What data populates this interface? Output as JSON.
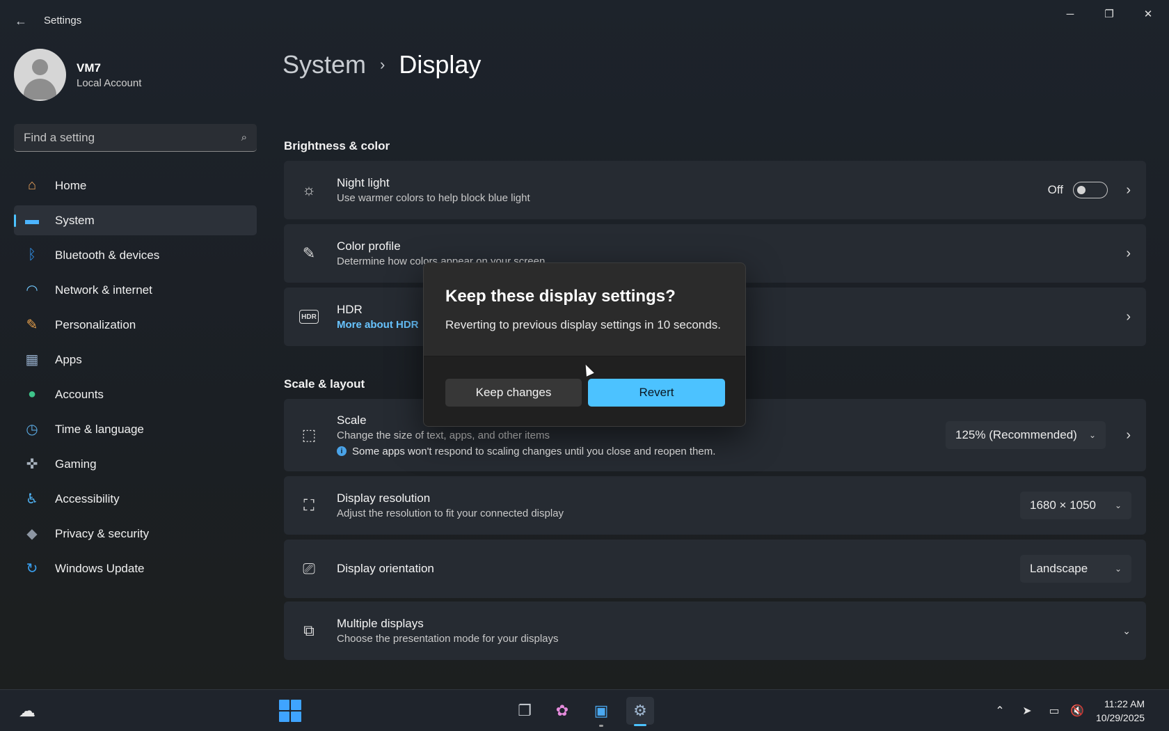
{
  "window": {
    "app_title": "Settings",
    "back_icon": "back-arrow-icon",
    "controls": {
      "minimize": "─",
      "maximize": "❐",
      "close": "✕"
    }
  },
  "profile": {
    "name": "VM7",
    "account_type": "Local Account"
  },
  "search": {
    "placeholder": "Find a setting",
    "icon": "⌕"
  },
  "sidebar": {
    "items": [
      {
        "label": "Home",
        "icon": "⌂",
        "icon_color": "#e8a15a",
        "active": false
      },
      {
        "label": "System",
        "icon": "▬",
        "icon_color": "#4cb4ff",
        "active": true
      },
      {
        "label": "Bluetooth & devices",
        "icon": "ᛒ",
        "icon_color": "#2f8de4",
        "active": false
      },
      {
        "label": "Network & internet",
        "icon": "◠",
        "icon_color": "#6fc3f7",
        "active": false
      },
      {
        "label": "Personalization",
        "icon": "✎",
        "icon_color": "#e9a14c",
        "active": false
      },
      {
        "label": "Apps",
        "icon": "▦",
        "icon_color": "#8fa6c2",
        "active": false
      },
      {
        "label": "Accounts",
        "icon": "●",
        "icon_color": "#3ec48a",
        "active": false
      },
      {
        "label": "Time & language",
        "icon": "◷",
        "icon_color": "#5aa8e0",
        "active": false
      },
      {
        "label": "Gaming",
        "icon": "✜",
        "icon_color": "#a8b2be",
        "active": false
      },
      {
        "label": "Accessibility",
        "icon": "♿",
        "icon_color": "#4fb0f0",
        "active": false
      },
      {
        "label": "Privacy & security",
        "icon": "◆",
        "icon_color": "#8d96a3",
        "active": false
      },
      {
        "label": "Windows Update",
        "icon": "↻",
        "icon_color": "#3aa0f0",
        "active": false
      }
    ]
  },
  "breadcrumb": {
    "parent": "System",
    "separator": "›",
    "current": "Display"
  },
  "sections": {
    "brightness": "Brightness & color",
    "scale_layout": "Scale & layout"
  },
  "cards": {
    "night_light": {
      "title": "Night light",
      "subtitle": "Use warmer colors to help block blue light",
      "toggle_label": "Off",
      "toggle_on": false,
      "icon": "☼"
    },
    "color_profile": {
      "title": "Color profile",
      "subtitle": "Determine how colors appear on your screen",
      "icon": "✎"
    },
    "hdr": {
      "title": "HDR",
      "link": "More about HDR",
      "icon": "HDR"
    },
    "scale": {
      "title": "Scale",
      "subtitle": "Change the size of text, apps, and other items",
      "note": "Some apps won't respond to scaling changes until you close and reopen them.",
      "value": "125% (Recommended)",
      "icon": "⬚"
    },
    "resolution": {
      "title": "Display resolution",
      "subtitle": "Adjust the resolution to fit your connected display",
      "value": "1680 × 1050",
      "icon": "⛶"
    },
    "orientation": {
      "title": "Display orientation",
      "value": "Landscape",
      "icon": "⎚"
    },
    "multiple": {
      "title": "Multiple displays",
      "subtitle": "Choose the presentation mode for your displays",
      "icon": "⧉"
    }
  },
  "dialog": {
    "title": "Keep these display settings?",
    "message": "Reverting to previous display settings in 10 seconds.",
    "keep_button": "Keep changes",
    "revert_button": "Revert"
  },
  "taskbar": {
    "apps": [
      {
        "name": "task-view",
        "icon": "❐"
      },
      {
        "name": "copilot",
        "icon": "✿"
      },
      {
        "name": "store",
        "icon": "▣"
      },
      {
        "name": "settings",
        "icon": "⚙"
      }
    ],
    "tray": {
      "chevron": "⌃",
      "location": "➤",
      "network": "▭",
      "volume": "🔇"
    },
    "time": "11:22 AM",
    "date": "10/29/2025"
  },
  "colors": {
    "accent": "#4cc2ff",
    "card_bg": "#262b32",
    "dialog_bg": "#2b2b2b"
  }
}
